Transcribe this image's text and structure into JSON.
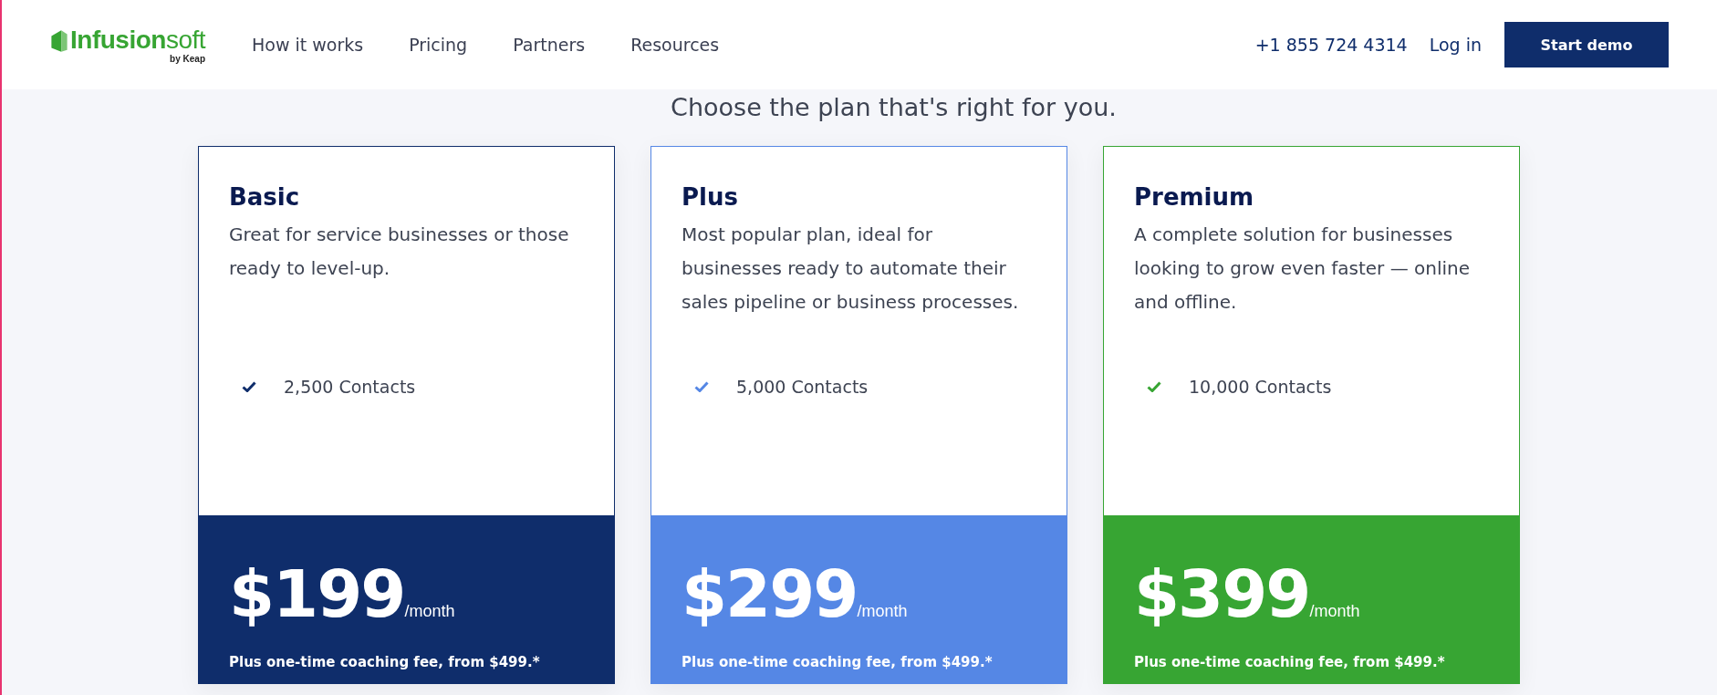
{
  "header": {
    "logo": {
      "name": "**Infusion**soft",
      "tagline": "by Keap"
    },
    "nav": [
      {
        "label": "How it works"
      },
      {
        "label": "Pricing"
      },
      {
        "label": "Partners"
      },
      {
        "label": "Resources"
      }
    ],
    "phone": "+1 855 724 4314",
    "login": "Log in",
    "cta": "Start demo"
  },
  "heading": "Choose the plan that's right for you.",
  "plans": [
    {
      "name": "Basic",
      "description": "Great for service businesses or those ready to level-up.",
      "feature": "2,500 Contacts",
      "color": "#0f2d6b",
      "price": "$199",
      "period": "/month",
      "note": "Plus one-time coaching fee, from $499.*"
    },
    {
      "name": "Plus",
      "description": "Most popular plan, ideal for businesses ready to automate their sales pipeline or business processes.",
      "feature": "5,000 Contacts",
      "color": "#5587e5",
      "price": "$299",
      "period": "/month",
      "note": "Plus one-time coaching fee, from $499.*"
    },
    {
      "name": "Premium",
      "description": "A complete solution for businesses looking to grow even faster — online and offline.",
      "feature": "10,000 Contacts",
      "color": "#37a533",
      "price": "$399",
      "period": "/month",
      "note": "Plus one-time coaching fee, from $499.*"
    }
  ]
}
